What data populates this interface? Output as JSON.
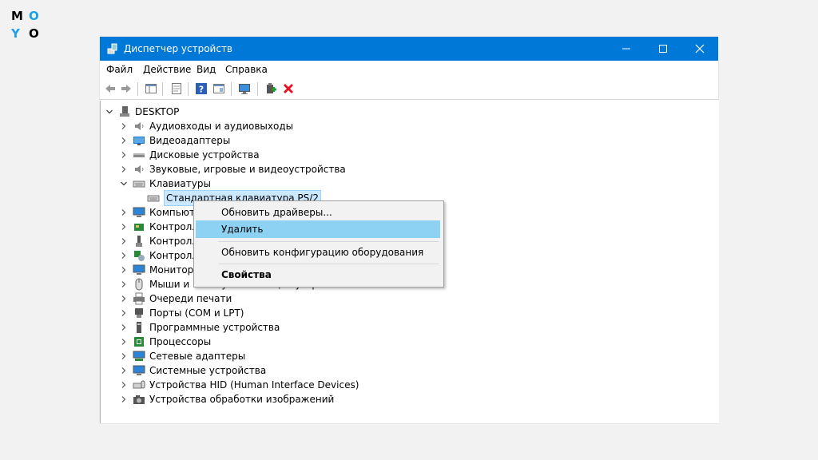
{
  "logo": {
    "letters": [
      "M",
      "O",
      "Y",
      "O"
    ]
  },
  "window": {
    "title": "Диспетчер устройств",
    "title_icon": "device-manager-icon",
    "controls": [
      "minimize-icon",
      "maximize-icon",
      "close-icon"
    ]
  },
  "menu": [
    "Файл",
    "Действие",
    "Вид",
    "Справка"
  ],
  "toolbar": {
    "icons": [
      "back-arrow-icon",
      "forward-arrow-icon",
      "show-hide-tree-icon",
      "properties-icon",
      "help-icon",
      "view-icon",
      "monitor-icon",
      "update-driver-icon",
      "uninstall-icon"
    ]
  },
  "tree": {
    "root": "DESKTOP",
    "items": [
      {
        "label": "Аудиовходы и аудиовыходы",
        "icon": "speaker-icon",
        "expanded": false
      },
      {
        "label": "Видеоадаптеры",
        "icon": "display-adapter-icon",
        "expanded": false
      },
      {
        "label": "Дисковые устройства",
        "icon": "disk-drive-icon",
        "expanded": false
      },
      {
        "label": "Звуковые, игровые и видеоустройства",
        "icon": "speaker-icon",
        "expanded": false
      },
      {
        "label": "Клавиатуры",
        "icon": "keyboard-icon",
        "expanded": true
      },
      {
        "label": "Стандартная клавиатура PS/2",
        "icon": "keyboard-icon",
        "child": true,
        "selected": true
      },
      {
        "label": "Компьютер",
        "icon": "computer-icon",
        "expanded": false
      },
      {
        "label": "Контроллеры IDE ATA/ATAPI",
        "icon": "ide-controller-icon",
        "expanded": false
      },
      {
        "label": "Контроллеры USB",
        "icon": "usb-icon",
        "expanded": false
      },
      {
        "label": "Контроллеры запоминающих устройств",
        "icon": "storage-controller-icon",
        "expanded": false
      },
      {
        "label": "Мониторы",
        "icon": "monitor-icon",
        "expanded": false
      },
      {
        "label": "Мыши и иные указывающие устройства",
        "icon": "mouse-icon",
        "expanded": false
      },
      {
        "label": "Очереди печати",
        "icon": "printer-icon",
        "expanded": false
      },
      {
        "label": "Порты (COM и LPT)",
        "icon": "port-icon",
        "expanded": false
      },
      {
        "label": "Программные устройства",
        "icon": "software-device-icon",
        "expanded": false
      },
      {
        "label": "Процессоры",
        "icon": "processor-icon",
        "expanded": false
      },
      {
        "label": "Сетевые адаптеры",
        "icon": "network-adapter-icon",
        "expanded": false
      },
      {
        "label": "Системные устройства",
        "icon": "system-device-icon",
        "expanded": false
      },
      {
        "label": "Устройства HID (Human Interface Devices)",
        "icon": "hid-icon",
        "expanded": false
      },
      {
        "label": "Устройства обработки изображений",
        "icon": "imaging-device-icon",
        "expanded": false
      }
    ]
  },
  "context_menu": {
    "items": [
      {
        "label": "Обновить драйверы...",
        "highlighted": false,
        "bold": false
      },
      {
        "label": "Удалить",
        "highlighted": true,
        "bold": false
      },
      {
        "label": "Обновить конфигурацию оборудования",
        "highlighted": false,
        "bold": false
      },
      {
        "label": "Свойства",
        "highlighted": false,
        "bold": true
      }
    ]
  },
  "colors": {
    "titlebar": "#0078d7",
    "highlight": "#8dd1f3",
    "selection": "#cce8ff",
    "uninstall": "#e81123"
  }
}
